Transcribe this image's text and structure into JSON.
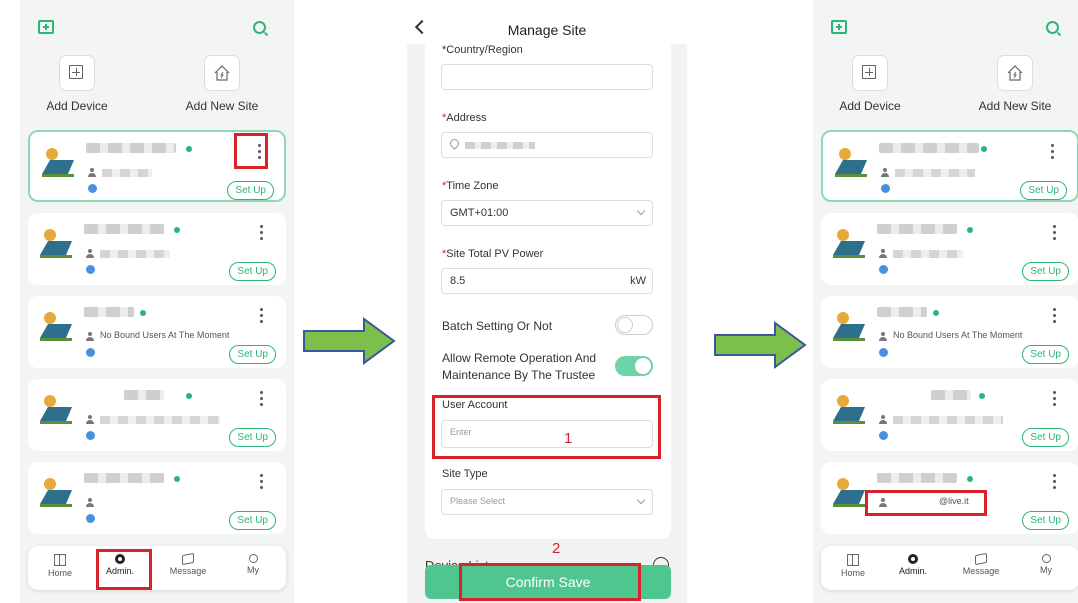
{
  "screen_left": {
    "quick": {
      "add_device": "Add Device",
      "add_site": "Add New Site"
    },
    "cards": [
      {
        "user_text": "",
        "setup": "Set Up"
      },
      {
        "user_text": "",
        "setup": "Set Up"
      },
      {
        "user_text": "No Bound Users At The Moment",
        "setup": "Set Up"
      },
      {
        "user_text": "",
        "setup": "Set Up"
      },
      {
        "user_text": "",
        "setup": "Set Up"
      }
    ],
    "nav": {
      "home": "Home",
      "admin": "Admin.",
      "message": "Message",
      "my": "My"
    }
  },
  "screen_middle": {
    "title": "Manage Site",
    "country_label": "*Country/Region",
    "address_label": "Address",
    "timezone_label": "Time Zone",
    "timezone_value": "GMT+01:00",
    "pv_label": "Site Total PV Power",
    "pv_value": "8.5",
    "pv_unit": "kW",
    "batch_label": "Batch Setting Or Not",
    "batch_on": false,
    "remote_label": "Allow Remote Operation And Maintenance By The Trustee",
    "remote_on": true,
    "user_account_label": "User Account",
    "user_account_placeholder": "Enter",
    "site_type_label": "Site Type",
    "site_type_placeholder": "Please Select",
    "device_list_label": "Device List",
    "confirm": "Confirm Save",
    "step1": "1",
    "step2": "2"
  },
  "screen_right": {
    "quick": {
      "add_device": "Add Device",
      "add_site": "Add New Site"
    },
    "cards": [
      {
        "user_text": "",
        "setup": "Set Up"
      },
      {
        "user_text": "",
        "setup": "Set Up"
      },
      {
        "user_text": "No Bound Users At The Moment",
        "setup": "Set Up"
      },
      {
        "user_text": "",
        "setup": "Set Up"
      },
      {
        "user_text": "@live.it",
        "setup": "Set Up"
      }
    ],
    "nav": {
      "home": "Home",
      "admin": "Admin.",
      "message": "Message",
      "my": "My"
    }
  },
  "colors": {
    "accent": "#2bb673",
    "highlight": "#d8232a",
    "arrow": "#7cc04b"
  }
}
